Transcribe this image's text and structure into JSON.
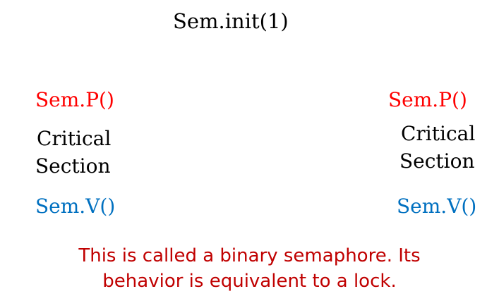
{
  "init": "Sem.init(1)",
  "left": {
    "p_op": "Sem.P()",
    "critical_line1": "Critical",
    "critical_line2": "Section",
    "v_op": "Sem.V()"
  },
  "right": {
    "p_op": "Sem.P()",
    "critical_line1": "Critical",
    "critical_line2": "Section",
    "v_op": "Sem.V()"
  },
  "note": {
    "line1": "This is called a binary semaphore. Its",
    "line2": "behavior is equivalent to a lock."
  },
  "colors": {
    "p_op": "#ff0000",
    "v_op": "#0070c0",
    "text": "#000000",
    "note": "#c00000"
  }
}
